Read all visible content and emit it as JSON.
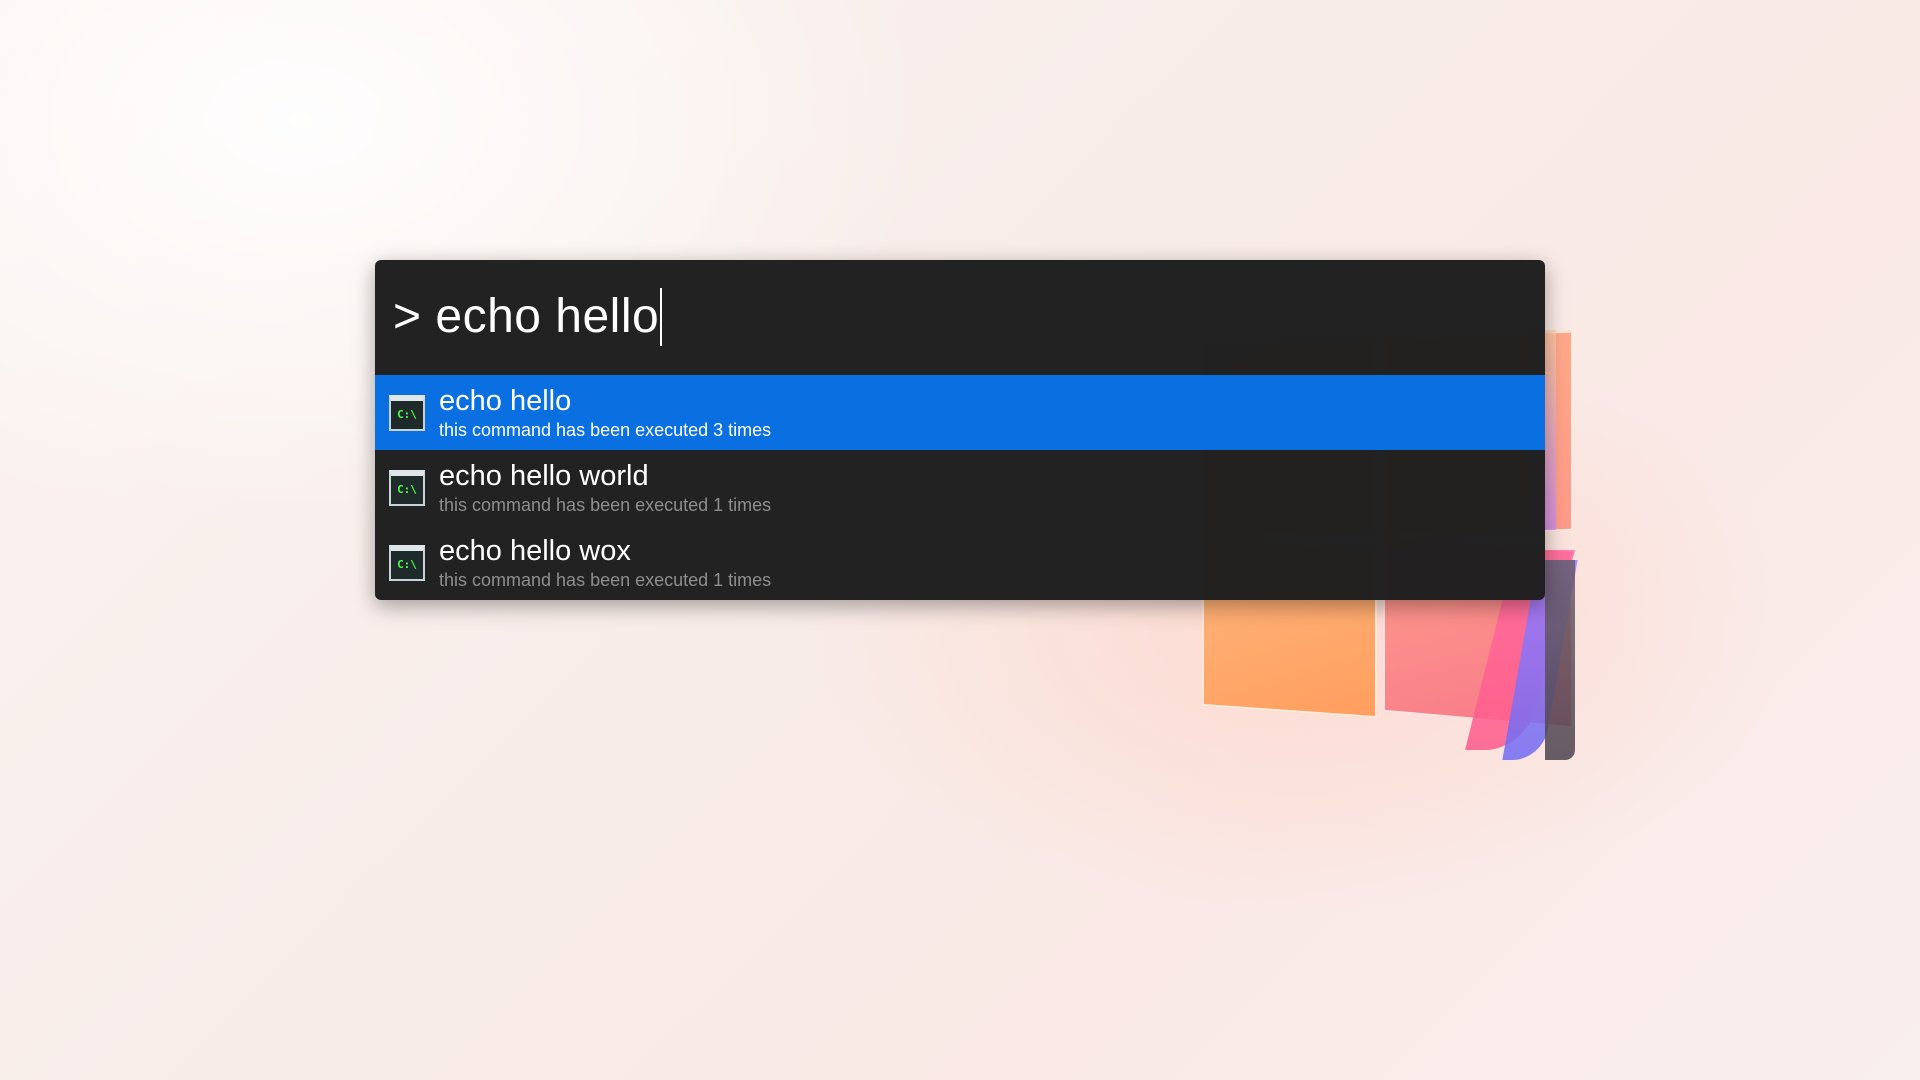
{
  "wallpaper": {
    "description_icon": "windows-logo-icon"
  },
  "launcher": {
    "query": "> echo hello",
    "results": [
      {
        "icon": "command-prompt-icon",
        "icon_text": "C:\\",
        "title": "echo hello",
        "subtitle": "this command has been executed 3 times",
        "selected": true
      },
      {
        "icon": "command-prompt-icon",
        "icon_text": "C:\\",
        "title": "echo hello world",
        "subtitle": "this command has been executed 1 times",
        "selected": false
      },
      {
        "icon": "command-prompt-icon",
        "icon_text": "C:\\",
        "title": "echo hello wox",
        "subtitle": "this command has been executed 1 times",
        "selected": false
      }
    ]
  },
  "colors": {
    "selection": "#0a6fe0",
    "panel": "#1e1e1e",
    "icon_text": "#4cff4c"
  }
}
